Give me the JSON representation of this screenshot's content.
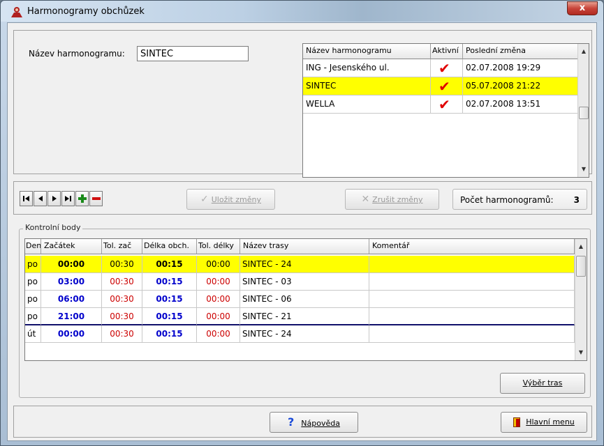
{
  "window": {
    "title": "Harmonogramy obchůzek",
    "close_label": "x"
  },
  "form": {
    "name_label": "Název harmonogramu:",
    "name_value": "SINTEC"
  },
  "schedules": {
    "columns": [
      "Název harmonogramu",
      "Aktivní",
      "Poslední změna"
    ],
    "rows": [
      {
        "name": "ING - Jesenského ul.",
        "active": true,
        "changed": "02.07.2008 19:29",
        "selected": false
      },
      {
        "name": "SINTEC",
        "active": true,
        "changed": "05.07.2008 21:22",
        "selected": true
      },
      {
        "name": "WELLA",
        "active": true,
        "changed": "02.07.2008 13:51",
        "selected": false
      }
    ]
  },
  "toolbar": {
    "save_label": "Uložit změny",
    "cancel_label": "Zrušit změny",
    "count_label": "Počet harmonogramů:",
    "count_value": "3"
  },
  "checkpoints": {
    "group_title": "Kontrolní body",
    "columns": [
      "Den",
      "Začátek",
      "Tol. zač",
      "Délka obch.",
      "Tol. délky",
      "Název trasy",
      "Komentář"
    ],
    "rows": [
      {
        "day": "po",
        "start": "00:00",
        "tol_start": "00:30",
        "length": "00:15",
        "tol_length": "00:00",
        "route": "SINTEC - 24",
        "comment": "",
        "selected": true
      },
      {
        "day": "po",
        "start": "03:00",
        "tol_start": "00:30",
        "length": "00:15",
        "tol_length": "00:00",
        "route": "SINTEC - 03",
        "comment": "",
        "selected": false
      },
      {
        "day": "po",
        "start": "06:00",
        "tol_start": "00:30",
        "length": "00:15",
        "tol_length": "00:00",
        "route": "SINTEC - 06",
        "comment": "",
        "selected": false
      },
      {
        "day": "po",
        "start": "21:00",
        "tol_start": "00:30",
        "length": "00:15",
        "tol_length": "00:00",
        "route": "SINTEC - 21",
        "comment": "",
        "selected": false
      },
      {
        "day": "út",
        "start": "00:00",
        "tol_start": "00:30",
        "length": "00:15",
        "tol_length": "00:00",
        "route": "SINTEC - 24",
        "comment": "",
        "selected": false
      }
    ],
    "routes_button": "Výběr tras"
  },
  "footer": {
    "help_label": "Nápověda",
    "main_menu_label": "Hlavní menu"
  },
  "colors": {
    "selected_row": "#ffff00",
    "time_blue": "#0000cc",
    "tolerance_red": "#cc0000",
    "check_red": "#e00000"
  }
}
